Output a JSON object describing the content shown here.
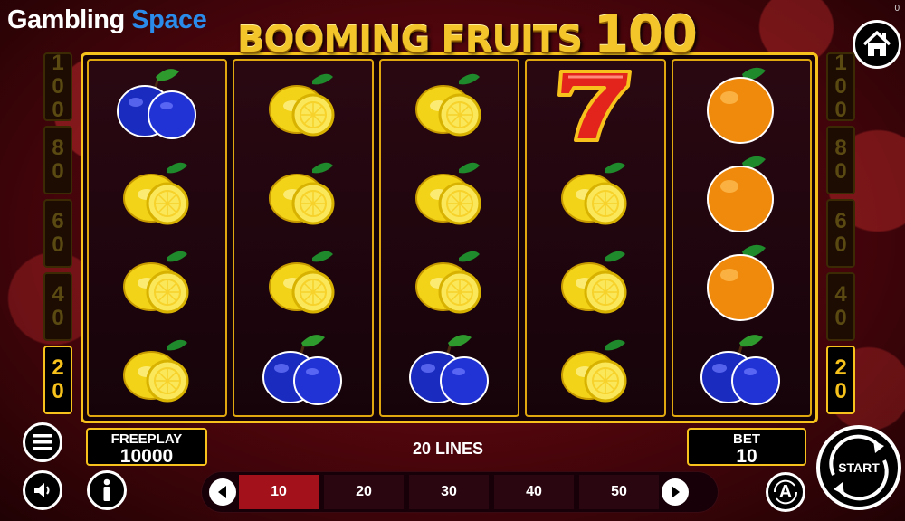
{
  "watermark": {
    "part1": "Gambling",
    "part2": "Space"
  },
  "game": {
    "title_part1": "BOOMING FRUITS",
    "title_part2": "100",
    "corner_label": "0"
  },
  "line_markers": {
    "left": [
      {
        "value": "100",
        "d1": "1",
        "d2": "0",
        "d3": "0",
        "active": false
      },
      {
        "value": "80",
        "d1": "8",
        "d2": "0",
        "active": false
      },
      {
        "value": "60",
        "d1": "6",
        "d2": "0",
        "active": false
      },
      {
        "value": "40",
        "d1": "4",
        "d2": "0",
        "active": false
      },
      {
        "value": "20",
        "d1": "2",
        "d2": "0",
        "active": true
      }
    ],
    "right": [
      {
        "value": "100",
        "d1": "1",
        "d2": "0",
        "d3": "0",
        "active": false
      },
      {
        "value": "80",
        "d1": "8",
        "d2": "0",
        "active": false
      },
      {
        "value": "60",
        "d1": "6",
        "d2": "0",
        "active": false
      },
      {
        "value": "40",
        "d1": "4",
        "d2": "0",
        "active": false
      },
      {
        "value": "20",
        "d1": "2",
        "d2": "0",
        "active": true
      }
    ]
  },
  "reels": [
    [
      "plum",
      "lemon",
      "lemon",
      "lemon"
    ],
    [
      "lemon",
      "lemon",
      "lemon",
      "plum"
    ],
    [
      "lemon",
      "lemon",
      "lemon",
      "plum"
    ],
    [
      "seven",
      "lemon",
      "lemon",
      "lemon"
    ],
    [
      "orange",
      "orange",
      "orange",
      "plum"
    ]
  ],
  "freeplay": {
    "label": "FREEPLAY",
    "value": "10000"
  },
  "lines_label": "20 LINES",
  "bet": {
    "label": "BET",
    "value": "10"
  },
  "bet_options": [
    "10",
    "20",
    "30",
    "40",
    "50"
  ],
  "selected_bet": "10",
  "auto_label": "A",
  "start_label": "START",
  "icons": [
    "home-icon",
    "menu-icon",
    "sound-icon",
    "info-icon",
    "arrow-left-icon",
    "arrow-right-icon",
    "autoplay-icon",
    "start-icon"
  ],
  "colors": {
    "gold": "#f6c21b",
    "background": "#4a050b",
    "selected_bet": "#a3111b",
    "logo_blue": "#2a8bea"
  }
}
